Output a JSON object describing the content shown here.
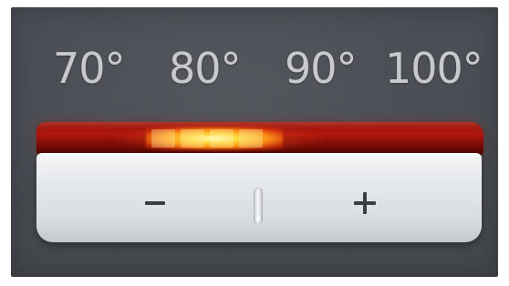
{
  "temperature_labels": [
    "70°",
    "80°",
    "90°",
    "100°"
  ],
  "controls": {
    "minus_icon": "minus-icon",
    "plus_icon": "plus-icon"
  },
  "indicator": {
    "lit_setting": "80°",
    "led_color": "#ff3a12",
    "glow_color": "#ffe07a"
  },
  "colors": {
    "panel": "#4a4e54",
    "label_text": "#c7c9cc",
    "button_strip": "#e7eaec",
    "glyph": "#3a3e43"
  }
}
